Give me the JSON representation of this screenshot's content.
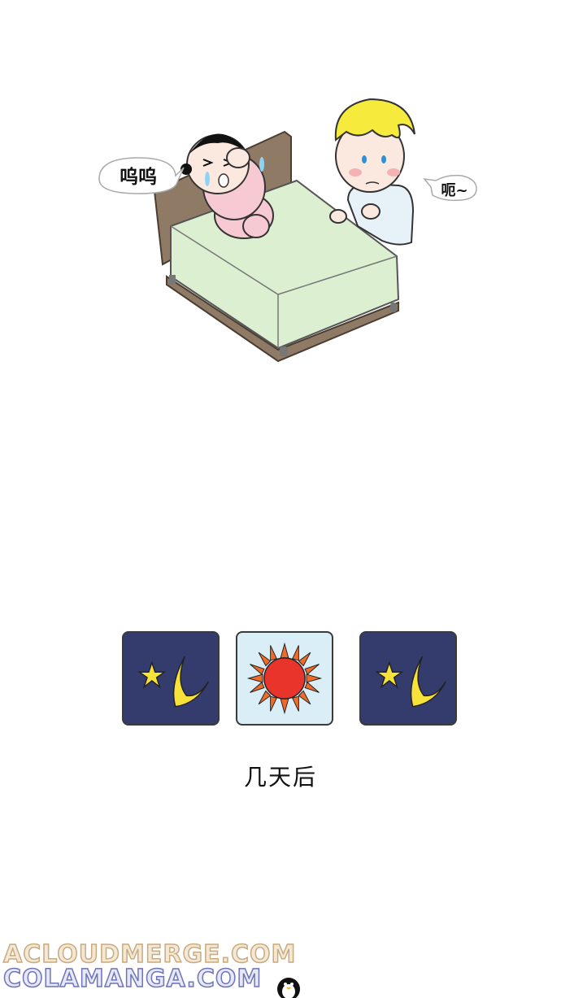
{
  "speech": {
    "left_bubble": "呜呜",
    "right_bubble": "呃~"
  },
  "caption": "几天后",
  "panels": [
    {
      "kind": "night",
      "icon": "moon-star"
    },
    {
      "kind": "day",
      "icon": "sun"
    },
    {
      "kind": "night",
      "icon": "moon-star"
    }
  ],
  "watermark": {
    "line1": "ACLOUDMERGE.COM",
    "line2": "COLAMANGA.COM"
  },
  "colors": {
    "night": "#343c6e",
    "day": "#d9eef7",
    "moon": "#f7e23a",
    "sun": "#e8342b",
    "sun_rays": "#ef6b2a",
    "sheet": "#dcefd0",
    "bed_frame": "#8f7a66"
  }
}
